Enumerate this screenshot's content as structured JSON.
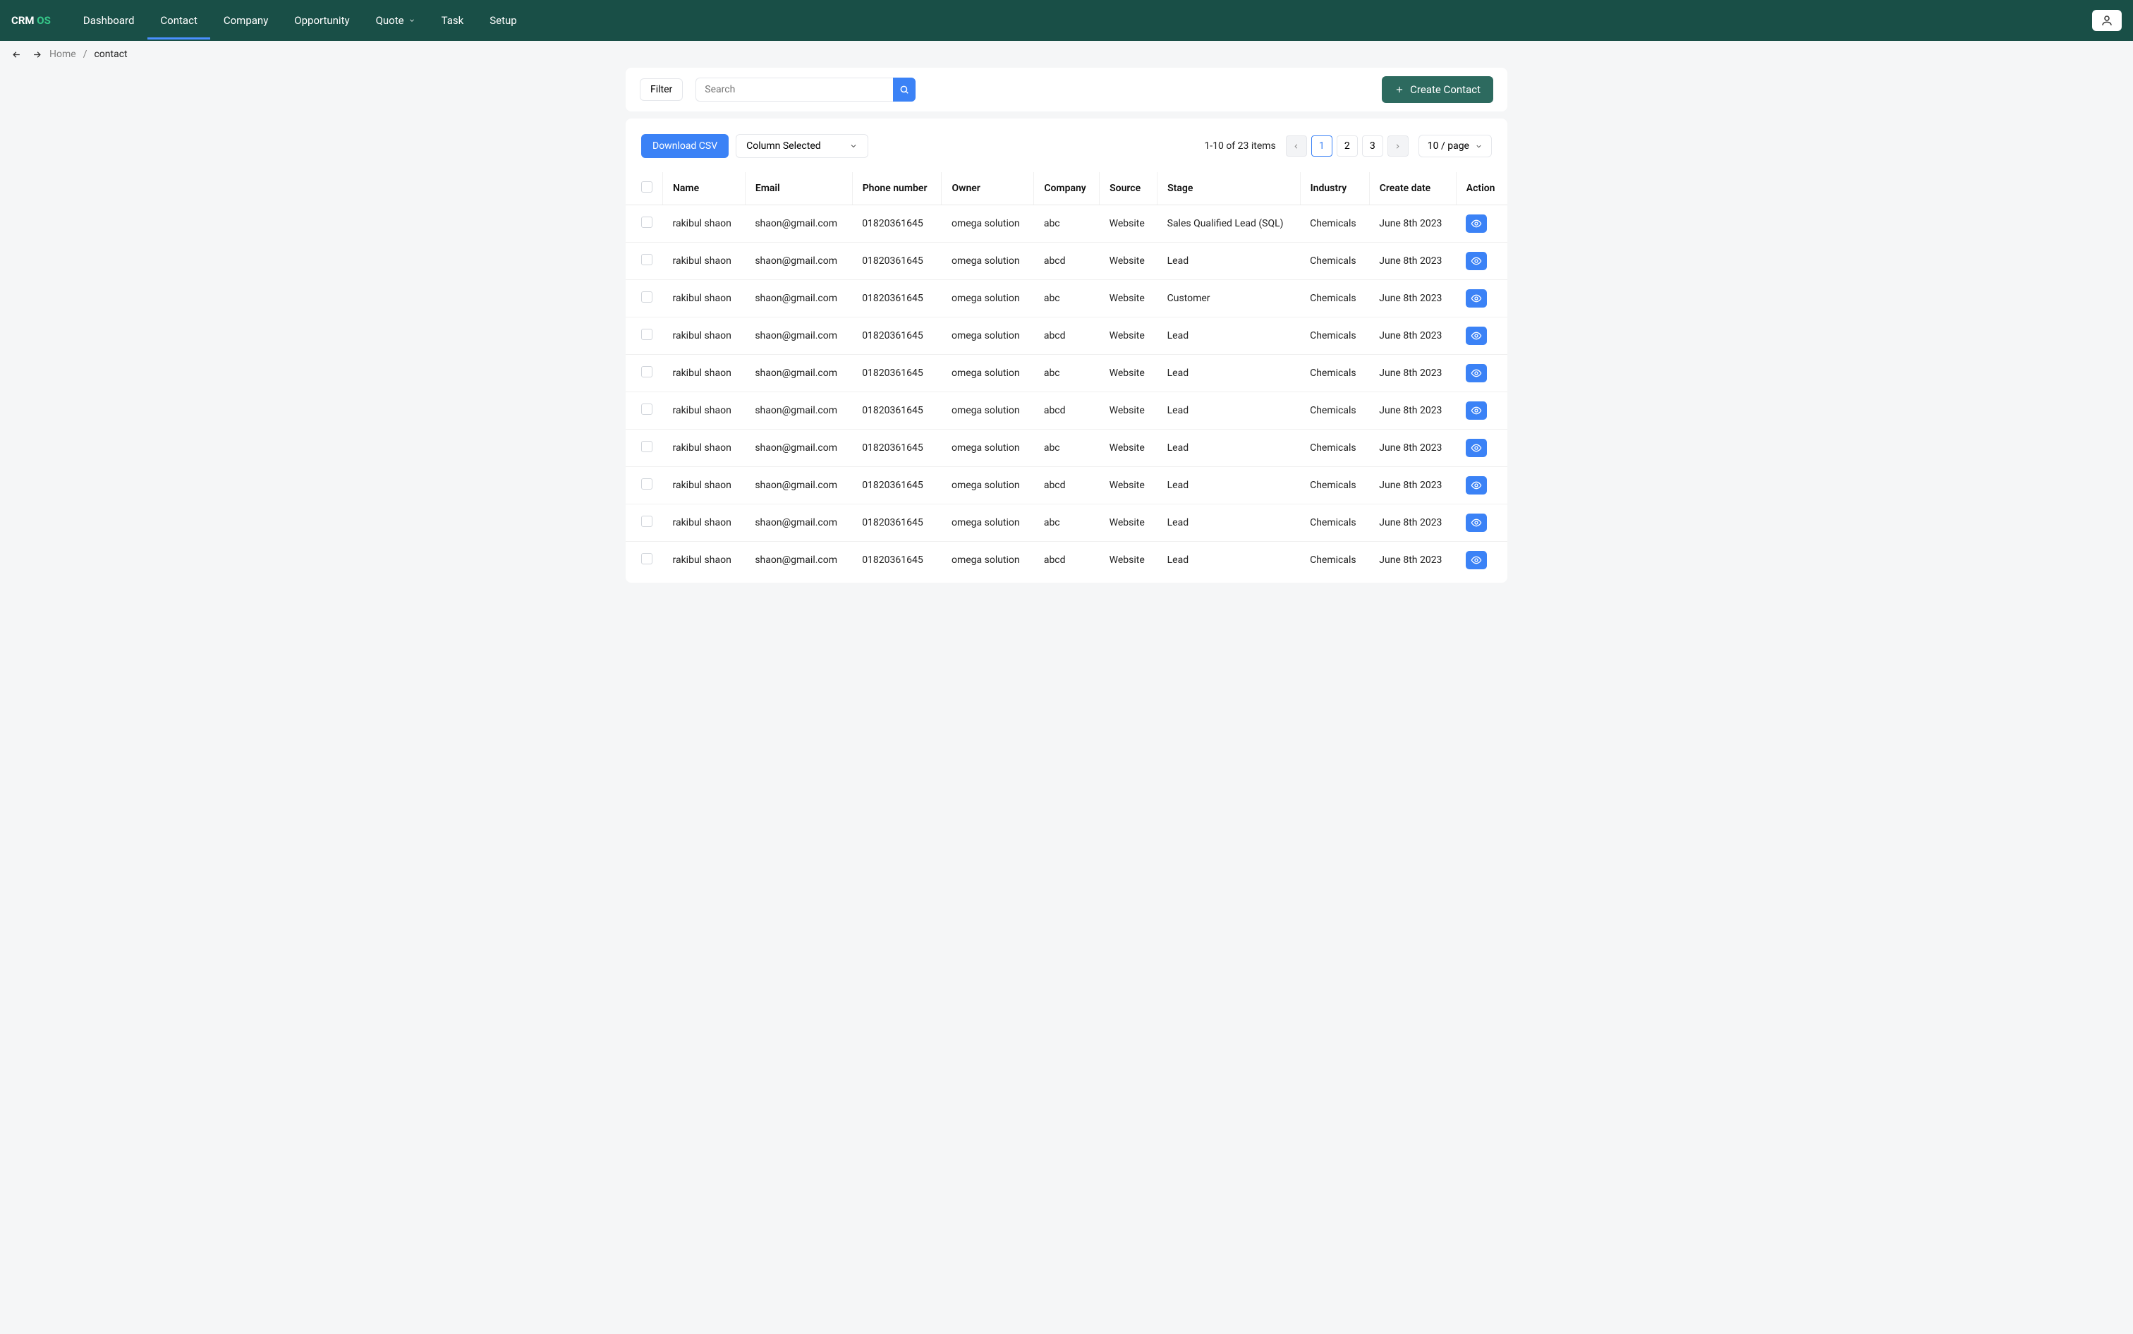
{
  "brand": {
    "crm": "CRM",
    "os": "OS"
  },
  "nav": {
    "items": [
      "Dashboard",
      "Contact",
      "Company",
      "Opportunity",
      "Quote",
      "Task",
      "Setup"
    ],
    "active": 1
  },
  "breadcrumb": {
    "home": "Home",
    "current": "contact"
  },
  "toolbar": {
    "filter": "Filter",
    "search_placeholder": "Search",
    "create": "Create Contact"
  },
  "table": {
    "download": "Download CSV",
    "column_selected": "Column Selected",
    "range": "1-10 of 23 items",
    "pages": [
      "1",
      "2",
      "3"
    ],
    "active_page": 0,
    "per_page": "10 / page",
    "headers": [
      "Name",
      "Email",
      "Phone number",
      "Owner",
      "Company",
      "Source",
      "Stage",
      "Industry",
      "Create date",
      "Action"
    ],
    "rows": [
      [
        "rakibul shaon",
        "shaon@gmail.com",
        "01820361645",
        "omega solution",
        "abc",
        "Website",
        "Sales Qualified Lead (SQL)",
        "Chemicals",
        "June 8th 2023"
      ],
      [
        "rakibul shaon",
        "shaon@gmail.com",
        "01820361645",
        "omega solution",
        "abcd",
        "Website",
        "Lead",
        "Chemicals",
        "June 8th 2023"
      ],
      [
        "rakibul shaon",
        "shaon@gmail.com",
        "01820361645",
        "omega solution",
        "abc",
        "Website",
        "Customer",
        "Chemicals",
        "June 8th 2023"
      ],
      [
        "rakibul shaon",
        "shaon@gmail.com",
        "01820361645",
        "omega solution",
        "abcd",
        "Website",
        "Lead",
        "Chemicals",
        "June 8th 2023"
      ],
      [
        "rakibul shaon",
        "shaon@gmail.com",
        "01820361645",
        "omega solution",
        "abc",
        "Website",
        "Lead",
        "Chemicals",
        "June 8th 2023"
      ],
      [
        "rakibul shaon",
        "shaon@gmail.com",
        "01820361645",
        "omega solution",
        "abcd",
        "Website",
        "Lead",
        "Chemicals",
        "June 8th 2023"
      ],
      [
        "rakibul shaon",
        "shaon@gmail.com",
        "01820361645",
        "omega solution",
        "abc",
        "Website",
        "Lead",
        "Chemicals",
        "June 8th 2023"
      ],
      [
        "rakibul shaon",
        "shaon@gmail.com",
        "01820361645",
        "omega solution",
        "abcd",
        "Website",
        "Lead",
        "Chemicals",
        "June 8th 2023"
      ],
      [
        "rakibul shaon",
        "shaon@gmail.com",
        "01820361645",
        "omega solution",
        "abc",
        "Website",
        "Lead",
        "Chemicals",
        "June 8th 2023"
      ],
      [
        "rakibul shaon",
        "shaon@gmail.com",
        "01820361645",
        "omega solution",
        "abcd",
        "Website",
        "Lead",
        "Chemicals",
        "June 8th 2023"
      ]
    ]
  }
}
